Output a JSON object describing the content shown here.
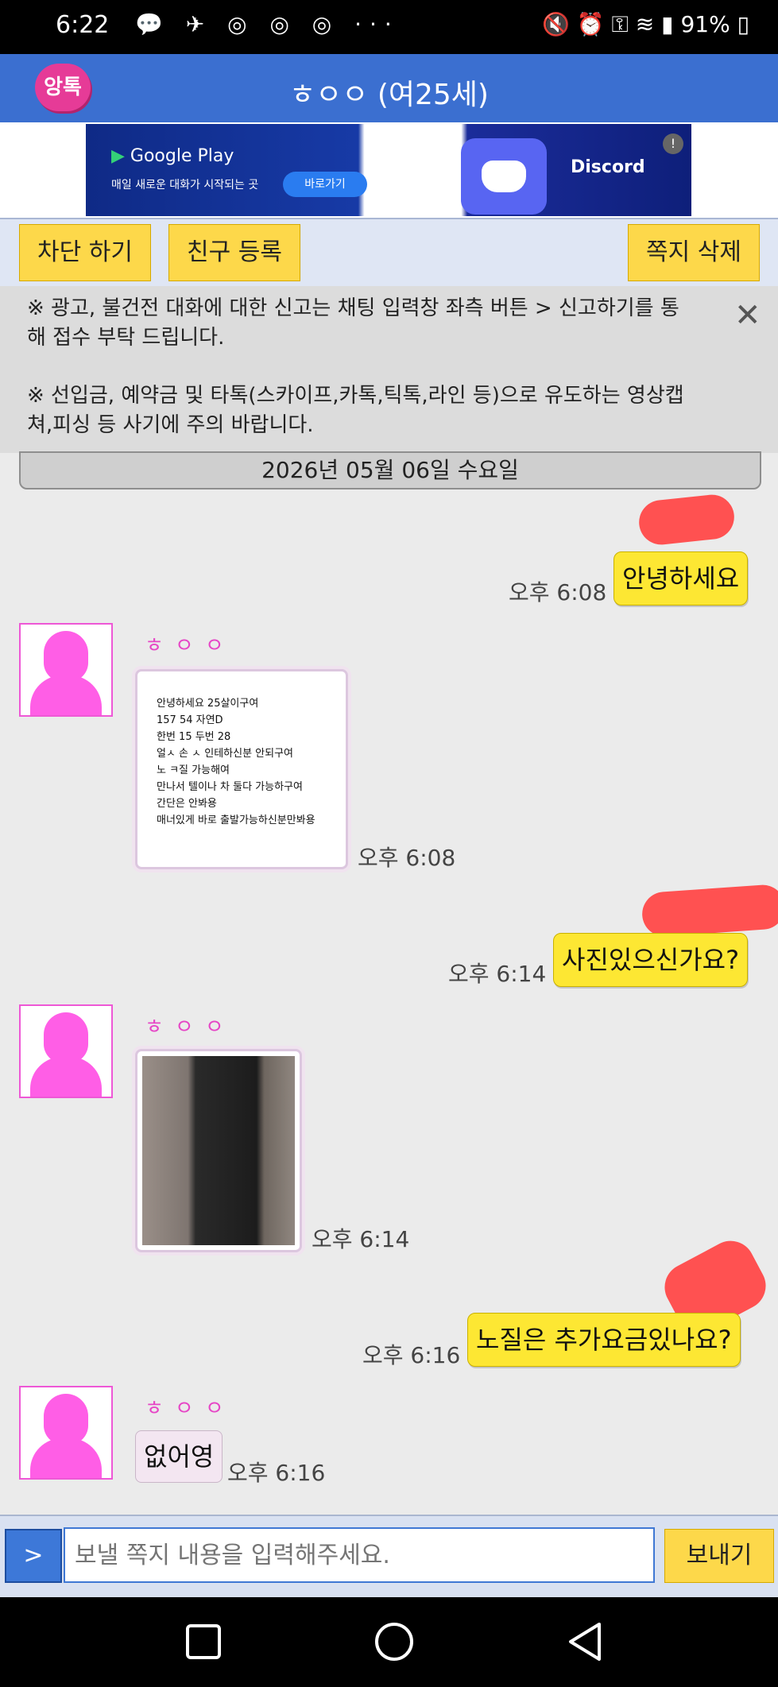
{
  "status": {
    "time": "6:22",
    "left_icons": "💬 ✈ ◎ ◎ ◎ ···",
    "battery": "91%"
  },
  "header": {
    "logo_text": "앙톡",
    "title": "ㅎㅇㅇ (여25세)"
  },
  "ad": {
    "store": "Google Play",
    "subtitle": "매일 새로운 대화가 시작되는 곳",
    "button": "바로가기",
    "brand": "Discord",
    "info_badge": "!"
  },
  "actions": {
    "block": "차단 하기",
    "add_friend": "친구 등록",
    "delete": "쪽지 삭제"
  },
  "notice": {
    "line1": "※ 광고, 불건전 대화에 대한 신고는 채팅 입력창 좌측 버튼 > 신고하기를 통해 접수 부탁 드립니다.",
    "line2": "※ 선입금, 예약금 및 타톡(스카이프,카톡,틱톡,라인 등)으로 유도하는 영상캡쳐,피싱 등 사기에 주의 바랍니다."
  },
  "date": "2026년 05월 06일 수요일",
  "messages": [
    {
      "from": "me",
      "text": "안녕하세요",
      "time": "오후 6:08"
    },
    {
      "from": "them",
      "name": "ㅎㅇㅇ",
      "image_text": [
        "안녕하세요 25살이구여",
        "157 54 자연D",
        "한번 15 두번 28",
        "얼ㅅ 손 ㅅ 인테하신분 안되구여",
        "노 ㅋ질 가능해여",
        "만나서 텔이나 차 둘다 가능하구여",
        "간단은 안봐용",
        "매너있게 바로 출발가능하신분만봐용"
      ],
      "time": "오후 6:08"
    },
    {
      "from": "me",
      "text": "사진있으신가요?",
      "time": "오후 6:14"
    },
    {
      "from": "them",
      "name": "ㅎㅇㅇ",
      "image": "photo",
      "time": "오후 6:14"
    },
    {
      "from": "me",
      "text": "노질은 추가요금있나요?",
      "time": "오후 6:16"
    },
    {
      "from": "them",
      "name": "ㅎㅇㅇ",
      "text": "없어영",
      "time": "오후 6:16"
    }
  ],
  "input": {
    "send_toggle": ">",
    "placeholder": "보낼 쪽지 내용을 입력해주세요.",
    "send": "보내기"
  },
  "colors": {
    "header": "#3b6fd0",
    "my_bubble": "#fde733",
    "button": "#fdd84a",
    "nickname": "#e646c6",
    "avatar": "#ff5ee6"
  }
}
